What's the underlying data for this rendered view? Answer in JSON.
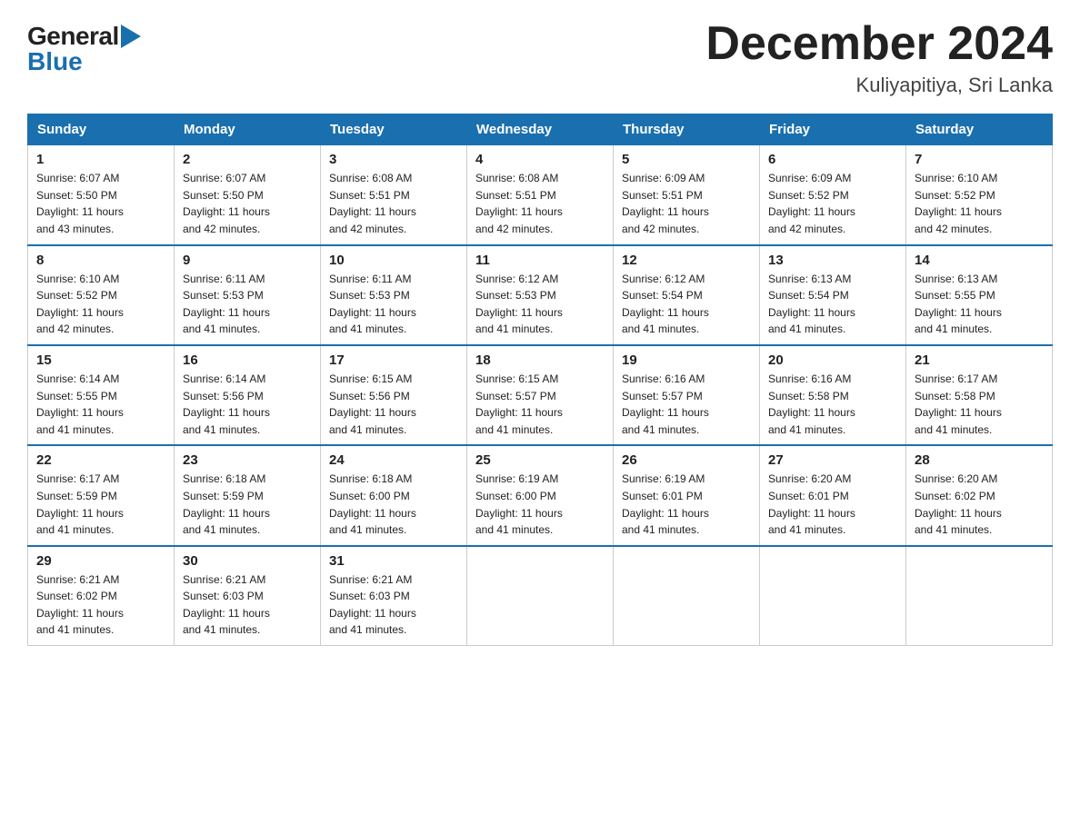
{
  "logo": {
    "general_text": "General",
    "blue_text": "Blue"
  },
  "header": {
    "title": "December 2024",
    "subtitle": "Kuliyapitiya, Sri Lanka"
  },
  "days_header": [
    "Sunday",
    "Monday",
    "Tuesday",
    "Wednesday",
    "Thursday",
    "Friday",
    "Saturday"
  ],
  "weeks": [
    [
      {
        "num": "1",
        "info": "Sunrise: 6:07 AM\nSunset: 5:50 PM\nDaylight: 11 hours\nand 43 minutes."
      },
      {
        "num": "2",
        "info": "Sunrise: 6:07 AM\nSunset: 5:50 PM\nDaylight: 11 hours\nand 42 minutes."
      },
      {
        "num": "3",
        "info": "Sunrise: 6:08 AM\nSunset: 5:51 PM\nDaylight: 11 hours\nand 42 minutes."
      },
      {
        "num": "4",
        "info": "Sunrise: 6:08 AM\nSunset: 5:51 PM\nDaylight: 11 hours\nand 42 minutes."
      },
      {
        "num": "5",
        "info": "Sunrise: 6:09 AM\nSunset: 5:51 PM\nDaylight: 11 hours\nand 42 minutes."
      },
      {
        "num": "6",
        "info": "Sunrise: 6:09 AM\nSunset: 5:52 PM\nDaylight: 11 hours\nand 42 minutes."
      },
      {
        "num": "7",
        "info": "Sunrise: 6:10 AM\nSunset: 5:52 PM\nDaylight: 11 hours\nand 42 minutes."
      }
    ],
    [
      {
        "num": "8",
        "info": "Sunrise: 6:10 AM\nSunset: 5:52 PM\nDaylight: 11 hours\nand 42 minutes."
      },
      {
        "num": "9",
        "info": "Sunrise: 6:11 AM\nSunset: 5:53 PM\nDaylight: 11 hours\nand 41 minutes."
      },
      {
        "num": "10",
        "info": "Sunrise: 6:11 AM\nSunset: 5:53 PM\nDaylight: 11 hours\nand 41 minutes."
      },
      {
        "num": "11",
        "info": "Sunrise: 6:12 AM\nSunset: 5:53 PM\nDaylight: 11 hours\nand 41 minutes."
      },
      {
        "num": "12",
        "info": "Sunrise: 6:12 AM\nSunset: 5:54 PM\nDaylight: 11 hours\nand 41 minutes."
      },
      {
        "num": "13",
        "info": "Sunrise: 6:13 AM\nSunset: 5:54 PM\nDaylight: 11 hours\nand 41 minutes."
      },
      {
        "num": "14",
        "info": "Sunrise: 6:13 AM\nSunset: 5:55 PM\nDaylight: 11 hours\nand 41 minutes."
      }
    ],
    [
      {
        "num": "15",
        "info": "Sunrise: 6:14 AM\nSunset: 5:55 PM\nDaylight: 11 hours\nand 41 minutes."
      },
      {
        "num": "16",
        "info": "Sunrise: 6:14 AM\nSunset: 5:56 PM\nDaylight: 11 hours\nand 41 minutes."
      },
      {
        "num": "17",
        "info": "Sunrise: 6:15 AM\nSunset: 5:56 PM\nDaylight: 11 hours\nand 41 minutes."
      },
      {
        "num": "18",
        "info": "Sunrise: 6:15 AM\nSunset: 5:57 PM\nDaylight: 11 hours\nand 41 minutes."
      },
      {
        "num": "19",
        "info": "Sunrise: 6:16 AM\nSunset: 5:57 PM\nDaylight: 11 hours\nand 41 minutes."
      },
      {
        "num": "20",
        "info": "Sunrise: 6:16 AM\nSunset: 5:58 PM\nDaylight: 11 hours\nand 41 minutes."
      },
      {
        "num": "21",
        "info": "Sunrise: 6:17 AM\nSunset: 5:58 PM\nDaylight: 11 hours\nand 41 minutes."
      }
    ],
    [
      {
        "num": "22",
        "info": "Sunrise: 6:17 AM\nSunset: 5:59 PM\nDaylight: 11 hours\nand 41 minutes."
      },
      {
        "num": "23",
        "info": "Sunrise: 6:18 AM\nSunset: 5:59 PM\nDaylight: 11 hours\nand 41 minutes."
      },
      {
        "num": "24",
        "info": "Sunrise: 6:18 AM\nSunset: 6:00 PM\nDaylight: 11 hours\nand 41 minutes."
      },
      {
        "num": "25",
        "info": "Sunrise: 6:19 AM\nSunset: 6:00 PM\nDaylight: 11 hours\nand 41 minutes."
      },
      {
        "num": "26",
        "info": "Sunrise: 6:19 AM\nSunset: 6:01 PM\nDaylight: 11 hours\nand 41 minutes."
      },
      {
        "num": "27",
        "info": "Sunrise: 6:20 AM\nSunset: 6:01 PM\nDaylight: 11 hours\nand 41 minutes."
      },
      {
        "num": "28",
        "info": "Sunrise: 6:20 AM\nSunset: 6:02 PM\nDaylight: 11 hours\nand 41 minutes."
      }
    ],
    [
      {
        "num": "29",
        "info": "Sunrise: 6:21 AM\nSunset: 6:02 PM\nDaylight: 11 hours\nand 41 minutes."
      },
      {
        "num": "30",
        "info": "Sunrise: 6:21 AM\nSunset: 6:03 PM\nDaylight: 11 hours\nand 41 minutes."
      },
      {
        "num": "31",
        "info": "Sunrise: 6:21 AM\nSunset: 6:03 PM\nDaylight: 11 hours\nand 41 minutes."
      },
      {
        "num": "",
        "info": ""
      },
      {
        "num": "",
        "info": ""
      },
      {
        "num": "",
        "info": ""
      },
      {
        "num": "",
        "info": ""
      }
    ]
  ]
}
